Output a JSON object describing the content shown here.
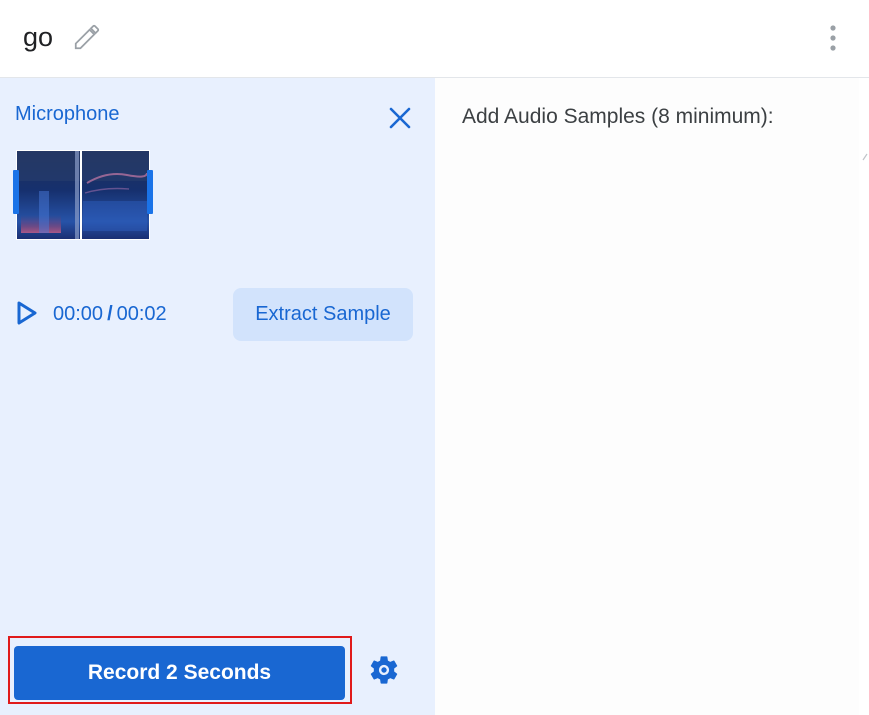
{
  "header": {
    "class_name": "go",
    "edit_icon": "pencil-icon",
    "menu_icon": "more-vert-icon"
  },
  "input_panel": {
    "title": "Microphone",
    "close_icon": "close-icon",
    "current_time": "00:00",
    "separator": "/",
    "total_time": "00:02",
    "play_icon": "play-icon",
    "extract_label": "Extract Sample",
    "record_label": "Record 2 Seconds",
    "settings_icon": "gear-icon"
  },
  "samples_panel": {
    "title": "Add Audio Samples (8 minimum):"
  },
  "colors": {
    "accent": "#1967d2",
    "panel_bg": "#e8f0fe",
    "extract_bg": "#d2e3fc",
    "highlight_border": "#e01a1a"
  }
}
